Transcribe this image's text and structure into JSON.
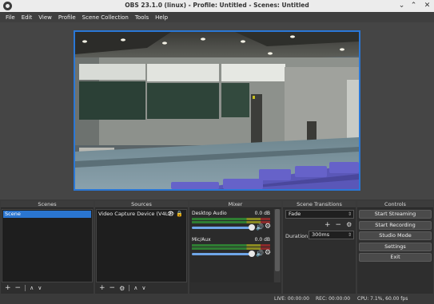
{
  "window": {
    "title": "OBS 23.1.0 (linux) - Profile: Untitled - Scenes: Untitled",
    "minimize": "⌄",
    "maximize": "⌃",
    "close": "✕"
  },
  "menu": [
    "File",
    "Edit",
    "View",
    "Profile",
    "Scene Collection",
    "Tools",
    "Help"
  ],
  "panels": {
    "scenes": {
      "title": "Scenes",
      "items": [
        "Scene"
      ],
      "footer": {
        "add": "+",
        "remove": "−",
        "up": "∧",
        "down": "∨"
      }
    },
    "sources": {
      "title": "Sources",
      "items": [
        {
          "label": "Video Capture Device (V4L2)",
          "icons": "👁 🔒"
        }
      ],
      "footer": {
        "add": "+",
        "remove": "−",
        "settings": "⚙",
        "up": "∧",
        "down": "∨"
      }
    },
    "mixer": {
      "title": "Mixer",
      "channels": [
        {
          "name": "Desktop Audio",
          "db": "0.0 dB",
          "volume_fraction": 1.0
        },
        {
          "name": "Mic/Aux",
          "db": "0.0 dB",
          "volume_fraction": 1.0
        }
      ]
    },
    "transitions": {
      "title": "Scene Transitions",
      "selected": "Fade",
      "add": "+",
      "remove": "−",
      "settings": "⚙",
      "duration_label": "Duration",
      "duration_value": "300ms"
    },
    "controls": {
      "title": "Controls",
      "buttons": [
        "Start Streaming",
        "Start Recording",
        "Studio Mode",
        "Settings",
        "Exit"
      ]
    }
  },
  "status": {
    "live": "LIVE: 00:00:00",
    "rec": "REC: 00:00:00",
    "cpu": "CPU: 7.1%, 60.00 fps"
  },
  "colors": {
    "accent": "#2a75d0",
    "preview_border": "#2a77d6"
  }
}
